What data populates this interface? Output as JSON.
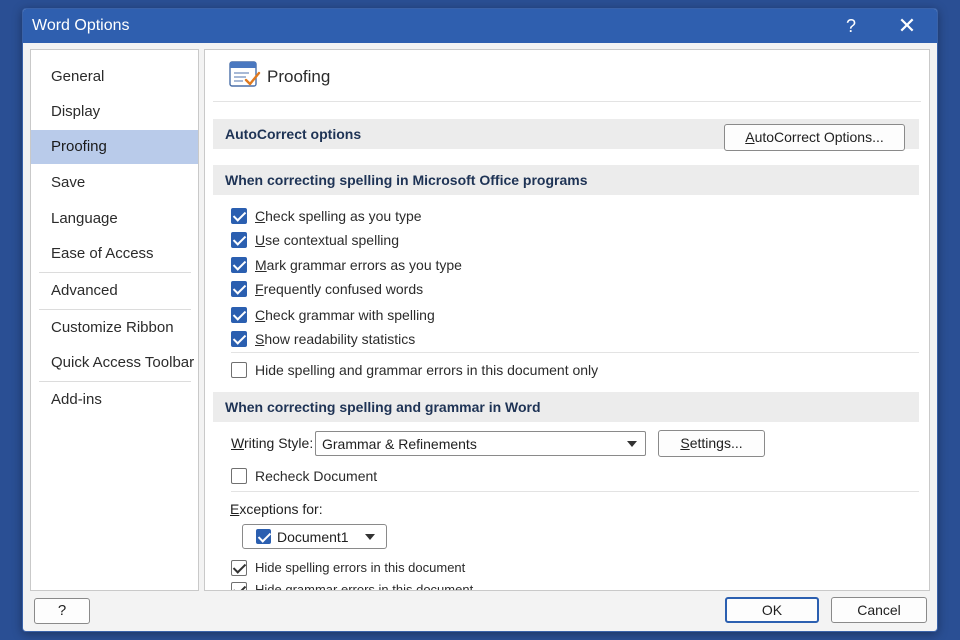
{
  "window": {
    "title": "Word Options",
    "help_glyph": "?",
    "close_glyph": "✕"
  },
  "nav": {
    "items": [
      {
        "label": "General"
      },
      {
        "label": "Display"
      },
      {
        "label": "Proofing",
        "active": true
      },
      {
        "label": "Save"
      },
      {
        "label": "Language"
      },
      {
        "label": "Ease of Access"
      },
      {
        "label": "Advanced"
      },
      {
        "label": "Customize Ribbon"
      },
      {
        "label": "Quick Access Toolbar"
      },
      {
        "label": "Add-ins"
      }
    ]
  },
  "page": {
    "title": "Proofing",
    "icon": "proofing-icon"
  },
  "autocorrect": {
    "heading": "AutoCorrect options",
    "button_label_rest": "utoCorrect Options...",
    "button_label_access": "A"
  },
  "office_spelling": {
    "heading": "When correcting spelling in Microsoft Office programs",
    "options": [
      {
        "access": "C",
        "rest": "heck spelling as you type",
        "checked": true
      },
      {
        "access": "U",
        "rest": "se contextual spelling",
        "checked": true
      },
      {
        "access": "M",
        "rest": "ark grammar errors as you type",
        "checked": true
      },
      {
        "access": "F",
        "rest": "requently confused words",
        "checked": true
      },
      {
        "access": "C",
        "rest": "heck grammar with spelling",
        "checked": true
      },
      {
        "access": "S",
        "rest": "how readability statistics",
        "checked": true
      },
      {
        "access": "",
        "rest": "Hide spelling and grammar errors in this document only",
        "checked": false
      }
    ]
  },
  "word_grammar": {
    "heading": "When correcting spelling and grammar in Word",
    "writing_style_access": "W",
    "writing_style_rest": "riting Style:",
    "writing_style_value": "Grammar & Refinements",
    "settings_access": "S",
    "settings_rest": "ettings...",
    "recheck_label": "Recheck Document",
    "recheck_checked": false
  },
  "exceptions": {
    "label_access": "E",
    "label_rest": "xceptions for:",
    "document_value": "Document1",
    "options": [
      {
        "label": "Hide spelling errors in this document",
        "checked": true
      },
      {
        "label": "Hide grammar errors in this document",
        "checked": true
      }
    ]
  },
  "footer": {
    "help_label": "?",
    "ok_label": "OK",
    "cancel_label": "Cancel"
  },
  "colors": {
    "accent": "#2b5fb0",
    "titlebar": "#2f5faf",
    "nav_selected": "#b9cbea",
    "background": "#2a4f94"
  }
}
